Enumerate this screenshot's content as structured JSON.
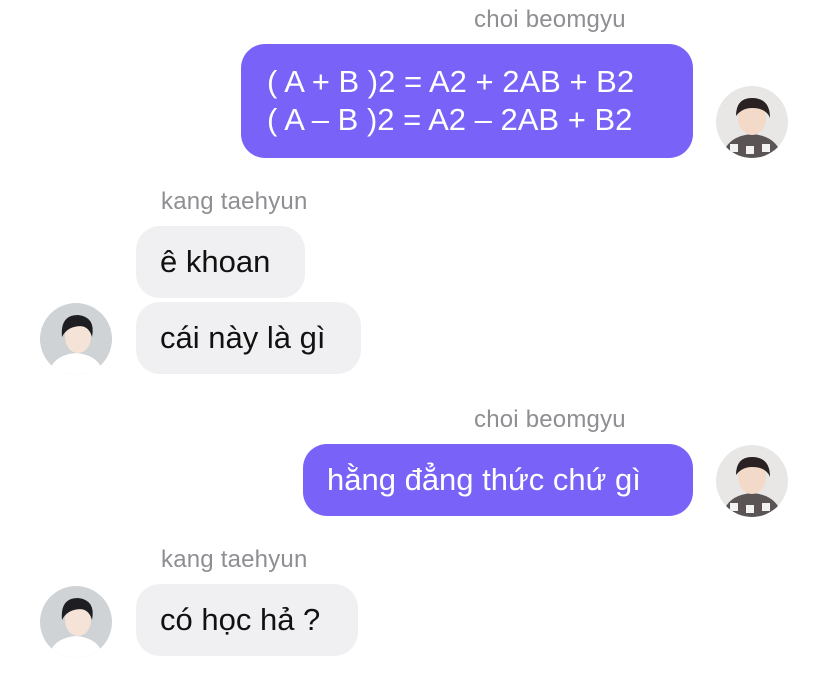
{
  "messages": [
    {
      "sender": "choi beomgyu",
      "side": "out",
      "lines": [
        "( A + B )2 = A2 + 2AB + B2",
        "( A – B )2 = A2 – 2AB + B2"
      ]
    },
    {
      "sender": "kang taehyun",
      "side": "in",
      "lines": [
        "ê khoan"
      ]
    },
    {
      "sender": "",
      "side": "in",
      "lines": [
        "cái này là gì"
      ]
    },
    {
      "sender": "choi beomgyu",
      "side": "out",
      "lines": [
        "hằng đẳng thức chứ gì"
      ]
    },
    {
      "sender": "kang taehyun",
      "side": "in",
      "lines": [
        "có học hả ?"
      ]
    }
  ],
  "colors": {
    "outgoing_bubble": "#7862f7",
    "incoming_bubble": "#f0f0f2",
    "sender_text": "#8e8e93"
  },
  "icons": {
    "beomgyu_avatar": "avatar-photo-icon",
    "taehyun_avatar": "avatar-photo-icon"
  }
}
